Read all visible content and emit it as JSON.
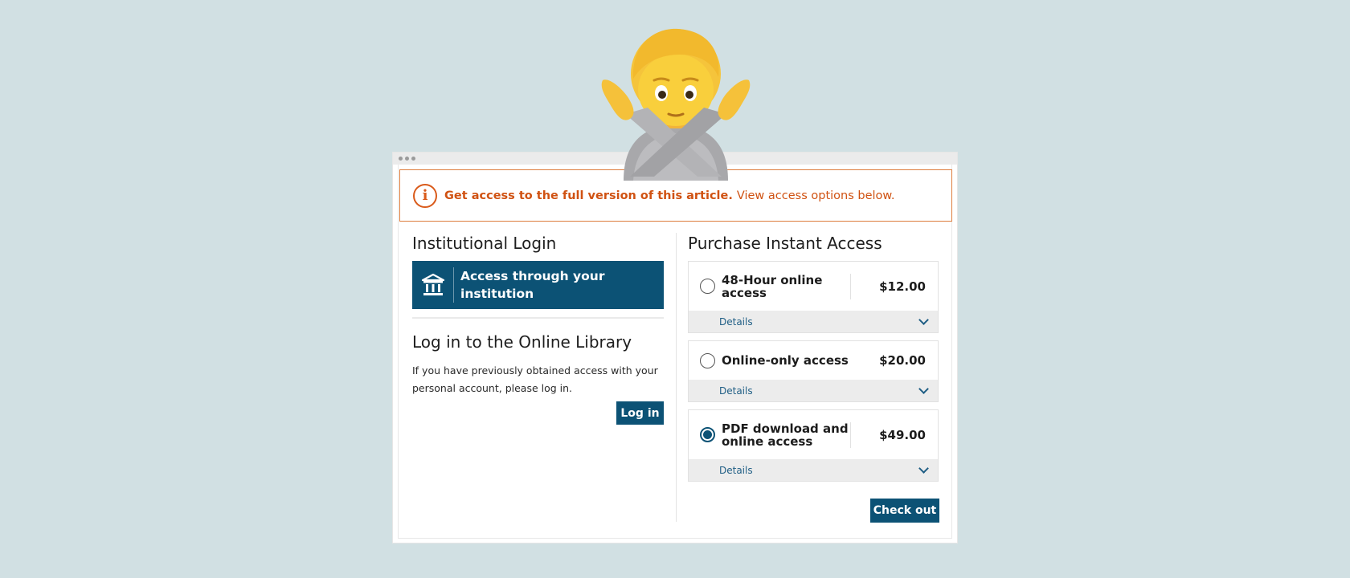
{
  "banner": {
    "strong": "Get access to the full version of this article.",
    "link": "View access options below."
  },
  "institutional": {
    "heading": "Institutional Login",
    "button_label": "Access through your institution"
  },
  "library": {
    "heading": "Log in to the Online Library",
    "text": "If you have previously obtained access with your personal account, please log in.",
    "login_label": "Log in"
  },
  "purchase": {
    "heading": "Purchase Instant Access",
    "options": [
      {
        "label": "48-Hour online access",
        "price": "$12.00",
        "details": "Details",
        "selected": false
      },
      {
        "label": "Online-only access",
        "price": "$20.00",
        "details": "Details",
        "selected": false
      },
      {
        "label": "PDF download and online access",
        "price": "$49.00",
        "details": "Details",
        "selected": true
      }
    ],
    "checkout_label": "Check out"
  },
  "colors": {
    "background": "#d1e0e3",
    "primary": "#0c5275",
    "alert": "#d05212"
  },
  "icons": [
    "info-icon",
    "institution-icon",
    "chevron-down-icon",
    "crossed-arms-person-emoji"
  ]
}
